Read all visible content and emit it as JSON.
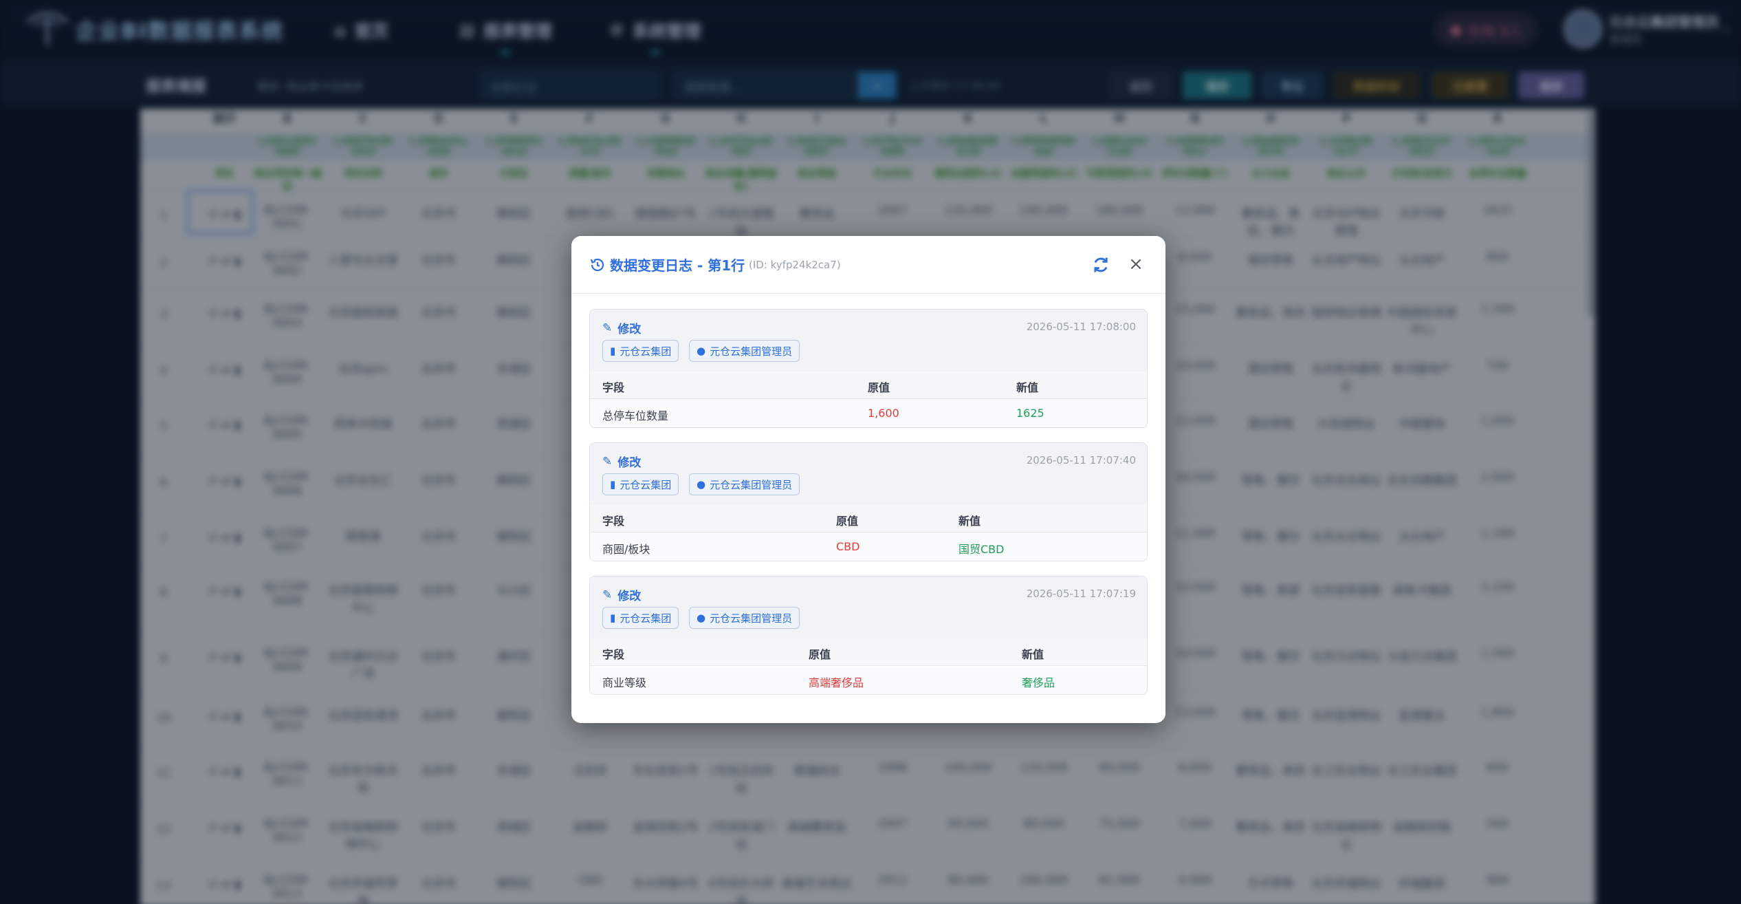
{
  "app": {
    "brand": "企业BI数据报表系统",
    "nav": [
      {
        "label": "首页",
        "icon": "home-icon"
      },
      {
        "label": "报表管理",
        "icon": "document-icon"
      },
      {
        "label": "系统管理",
        "icon": "gear-icon"
      }
    ],
    "online": "在线 9人",
    "user": {
      "name": "元仓云集团管理员",
      "role": "管理员"
    }
  },
  "toolbar": {
    "title": "报表填报",
    "subtitle": "报告: 商业某卡后商务",
    "select_placeholder": "全部企业",
    "search_placeholder": "搜索数据...",
    "saved_time": "上次保存 17:08:06",
    "buttons": [
      "返回",
      "保存",
      "导出",
      "数据校验",
      "已变更",
      "保存"
    ]
  },
  "sheet": {
    "columns": [
      "操作",
      "B",
      "C",
      "D",
      "E",
      "F",
      "G",
      "H",
      "I",
      "J",
      "K",
      "L",
      "M",
      "N",
      "O",
      "P",
      "Q",
      "R"
    ],
    "hashes": [
      "f_942c4652 9484",
      "f_46075c84 1633",
      "f_508ea51c cb0e",
      "f_45984f61 a61d",
      "f_f0e57ac99 273",
      "f_c5d688e8 76e2",
      "f_cb372acd2 069",
      "f_9e427dee 4697",
      "f_627b17c3 4df4",
      "f_69a4b448 5c29",
      "f_9694d99bf 4ad",
      "f_8961a2d 11d3",
      "f_b4998af2 80cc",
      "f_00a6f629 0370",
      "f_2198a38 2a77",
      "f_39822137 9022",
      "f_483c33e1 7e34"
    ],
    "fields": [
      "项目",
      "商业项目唯一编码",
      "项目名称",
      "城市",
      "行政区",
      "商圈/板块",
      "详细地址",
      "商业体量(建筑面积)",
      "商业等级",
      "开业年份",
      "建筑总面积(㎡)",
      "总建筑面积(㎡)",
      "可租赁面积(㎡)",
      "停车位数量(个)",
      "主力业态",
      "物业公司",
      "开发商/投资方",
      "总停车位数量"
    ],
    "rows": [
      {
        "n": "1",
        "cells": [
          "BJ-COM-0001",
          "北京SKP",
          "北京市",
          "朝阳区",
          "国贸CBD",
          "建国路87号",
          "1号线大望路站",
          "奢侈品",
          "2007",
          "120,000",
          "240,000",
          "180,000",
          "12,000",
          "奢侈品、美妆、餐饮",
          "北京SKP物业管理",
          "北京华联",
          "1625"
        ]
      },
      {
        "n": "2",
        "cells": [
          "BJ-COM-0002",
          "三里屯太古里",
          "北京市",
          "朝阳区",
          "",
          "",
          "",
          "",
          "",
          "",
          "",
          "",
          "8,000",
          "潮流零售",
          "太古地产物业",
          "太古地产",
          "800"
        ]
      },
      {
        "n": "3",
        "cells": [
          "BJ-COM-0003",
          "北京国贸商城",
          "北京市",
          "朝阳区",
          "",
          "",
          "",
          "",
          "",
          "",
          "",
          "",
          "15,000",
          "奢侈品、商务",
          "国贸物业管理",
          "中国国际贸易中心",
          "1,500"
        ]
      },
      {
        "n": "4",
        "cells": [
          "BJ-COM-0004",
          "北京apm",
          "北京市",
          "东城区",
          "",
          "",
          "",
          "",
          "",
          "",
          "",
          "",
          "10,000",
          "潮流零售",
          "北京新鸿基物业",
          "新鸿基地产",
          "700"
        ]
      },
      {
        "n": "5",
        "cells": [
          "BJ-COM-0005",
          "西单大悦城",
          "北京市",
          "西城区",
          "",
          "",
          "",
          "",
          "",
          "",
          "",
          "",
          "12,000",
          "潮流零售",
          "大悦城物业",
          "中粮置地",
          "1,000"
        ]
      },
      {
        "n": "6",
        "cells": [
          "BJ-COM-0006",
          "北京合生汇",
          "北京市",
          "朝阳区",
          "",
          "",
          "",
          "",
          "",
          "",
          "",
          "",
          "16,000",
          "零售、餐饮",
          "北京合生商业",
          "合生创展集团",
          "2,600"
        ]
      },
      {
        "n": "7",
        "cells": [
          "BJ-COM-0007",
          "颐堤港",
          "北京市",
          "朝阳区",
          "",
          "",
          "",
          "",
          "",
          "",
          "",
          "",
          "11,000",
          "零售、餐饮",
          "北京太古物业",
          "太古地产",
          "1,200"
        ]
      },
      {
        "n": "8",
        "cells": [
          "BJ-COM-0008",
          "北京荟聚购物中心",
          "北京市",
          "大兴区",
          "",
          "",
          "",
          "",
          "",
          "",
          "",
          "",
          "15,000",
          "零售、家居",
          "北京宜家荟聚",
          "英格卡集团",
          "3,100"
        ]
      },
      {
        "n": "9",
        "cells": [
          "BJ-COM-0009",
          "北京通州万达广场",
          "北京市",
          "通州区",
          "",
          "",
          "",
          "",
          "",
          "",
          "",
          "",
          "10,000",
          "零售、餐饮",
          "北京万达物业",
          "大连万达集团",
          "1,500"
        ]
      },
      {
        "n": "10",
        "cells": [
          "BJ-COM-0010",
          "北京蓝色港湾",
          "北京市",
          "朝阳区",
          "",
          "",
          "",
          "",
          "",
          "",
          "",
          "",
          "13,000",
          "零售、餐饮",
          "北京蓝港物业",
          "蓝港置业",
          "1,800"
        ]
      },
      {
        "n": "11",
        "cells": [
          "BJ-COM-0011",
          "北京东方新天地",
          "北京市",
          "东城区",
          "王府井",
          "东长安街1号",
          "1号线王府井站",
          "高端综合",
          "1998",
          "100,000",
          "120,000",
          "80,000",
          "8,000",
          "奢侈品、商务",
          "长江实业物业",
          "长江实业集团",
          "600"
        ]
      },
      {
        "n": "12",
        "cells": [
          "BJ-COM-0012",
          "北京金融街购物中心",
          "北京市",
          "西城区",
          "金融街",
          "金城坊街2号",
          "2号线阜成门站",
          "高端奢侈品",
          "2007",
          "90,000",
          "89,000",
          "75,000",
          "7,000",
          "奢侈品、商务",
          "北京金融街物业",
          "金融街控股",
          "500"
        ]
      },
      {
        "n": "13",
        "cells": [
          "BJ-COM-0013",
          "北京侨福芳草地",
          "北京市",
          "朝阳区",
          "CBD",
          "东大桥路9号",
          "6号线东大桥站",
          "高端艺术商业",
          "2012",
          "80,000",
          "200,000",
          "82,000",
          "9,000",
          "艺术零售",
          "北京侨福物业",
          "侨福集团",
          "800"
        ]
      }
    ]
  },
  "modal": {
    "title": "数据变更日志 - 第1行",
    "record_id": "(ID: kyfp24k2ca7)",
    "table_headers": {
      "field": "字段",
      "old": "原值",
      "new": "新值"
    },
    "logs": [
      {
        "action": "修改",
        "time": "2026-05-11 17:08:00",
        "org": "元仓云集团",
        "user": "元仓云集团管理员",
        "field": "总停车位数量",
        "old": "1,600",
        "new": "1625"
      },
      {
        "action": "修改",
        "time": "2026-05-11 17:07:40",
        "org": "元仓云集团",
        "user": "元仓云集团管理员",
        "field": "商圈/板块",
        "old": "CBD",
        "new": "国贸CBD"
      },
      {
        "action": "修改",
        "time": "2026-05-11 17:07:19",
        "org": "元仓云集团",
        "user": "元仓云集团管理员",
        "field": "商业等级",
        "old": "高端奢侈品",
        "new": "奢侈品"
      }
    ]
  },
  "colors": {
    "accent": "#2f6fde",
    "old_value": "#e03b3b",
    "new_value": "#1f9d5a"
  }
}
